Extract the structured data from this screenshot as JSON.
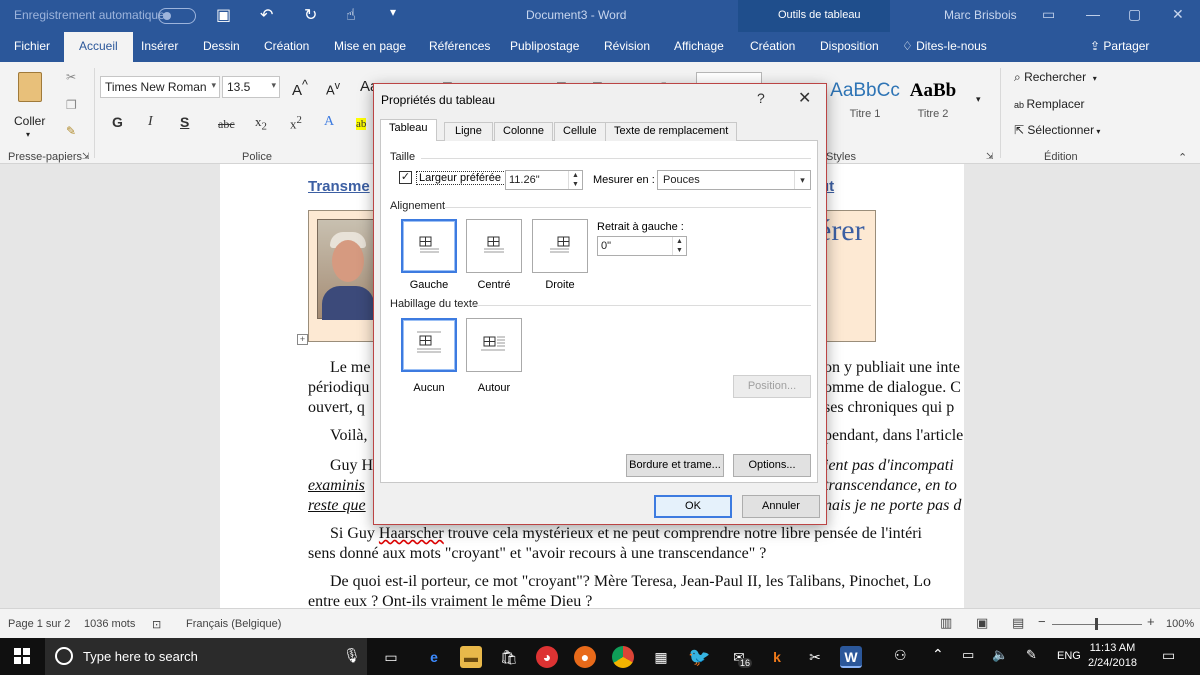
{
  "titlebar": {
    "autosave": "Enregistrement automatique",
    "document_name": "Document3 - Word",
    "context_group": "Outils de tableau",
    "user": "Marc Brisbois"
  },
  "ribbon_tabs": {
    "file": "Fichier",
    "items": [
      "Accueil",
      "Insérer",
      "Dessin",
      "Création",
      "Mise en page",
      "Références",
      "Publipostage",
      "Révision",
      "Affichage",
      "Création",
      "Disposition"
    ],
    "tell_me": "Dites-le-nous",
    "share": "Partager"
  },
  "ribbon": {
    "paste": "Coller",
    "font_name": "Times New Roman",
    "font_size": "13.5",
    "groups": {
      "clipboard": "Presse-papiers",
      "font": "Police",
      "styles": "Styles",
      "editing": "Édition"
    },
    "styles": [
      {
        "preview": "AaBbCc",
        "name": "Titre 1"
      },
      {
        "preview": "AaBb",
        "name": "Titre 2"
      }
    ],
    "editing": {
      "find": "Rechercher",
      "replace": "Remplacer",
      "select": "Sélectionner"
    }
  },
  "document": {
    "link_title_left": "Transme",
    "link_title_right": "ut",
    "header_word": "érer",
    "p1_left": "Le me",
    "p1_right": "on y publiait une inte",
    "p1b_left": "périodiqu",
    "p1b_right": "omme de dialogue. C",
    "p1c_left": "ouvert, q",
    "p1c_right": "ses chroniques qui p",
    "p2_left": "Voilà,",
    "p2_right": "pendant, dans l'article",
    "p3_left": "Guy H",
    "p3_right": "ient pas d'incompati",
    "p3b_left": "examinis",
    "p3b_right": "transcendance, en to",
    "p3c_left": "reste que",
    "p3c_right": "nais je ne porte pas d",
    "p4_line1_a": "Si Guy ",
    "p4_line1_b": "Haarscher",
    "p4_line1_c": " trouve cela mystérieux et ne peut comprendre notre libre pensée de l'intéri",
    "p4_line2": "sens donné aux mots \"croyant\" et \"avoir recours à une transcendance\" ?",
    "p5_line1": "De quoi est-il porteur, ce mot \"croyant\"? Mère Teresa, Jean-Paul II, les Talibans, Pinochet, Lo",
    "p5_line2": "entre eux ? Ont-ils vraiment le même Dieu ?"
  },
  "statusbar": {
    "page": "Page 1 sur 2",
    "words": "1036 mots",
    "language": "Français (Belgique)",
    "zoom": "100%"
  },
  "taskbar": {
    "search_placeholder": "Type here to search",
    "mail_badge": "16",
    "language": "ENG",
    "time": "11:13 AM",
    "date": "2/24/2018"
  },
  "dialog": {
    "title": "Propriétés du tableau",
    "help": "?",
    "tabs": [
      "Tableau",
      "Ligne",
      "Colonne",
      "Cellule",
      "Texte de remplacement"
    ],
    "size_section": "Taille",
    "preferred_width_label": "Largeur préférée :",
    "preferred_width_checked": true,
    "preferred_width_value": "11.26\"",
    "measure_in_label": "Mesurer en :",
    "measure_in_value": "Pouces",
    "alignment_section": "Alignement",
    "alignment_options": [
      "Gauche",
      "Centré",
      "Droite"
    ],
    "alignment_selected": "Gauche",
    "indent_label": "Retrait à gauche :",
    "indent_value": "0\"",
    "wrap_section": "Habillage du texte",
    "wrap_options": [
      "Aucun",
      "Autour"
    ],
    "wrap_selected": "Aucun",
    "position_button": "Position...",
    "borders_button": "Bordure et trame...",
    "options_button": "Options...",
    "ok_button": "OK",
    "cancel_button": "Annuler"
  },
  "colors": {
    "word_blue": "#2b579a",
    "link_blue": "#3c5fa3",
    "selection_blue": "#3d7be0",
    "header_bg": "#fde9d3"
  }
}
